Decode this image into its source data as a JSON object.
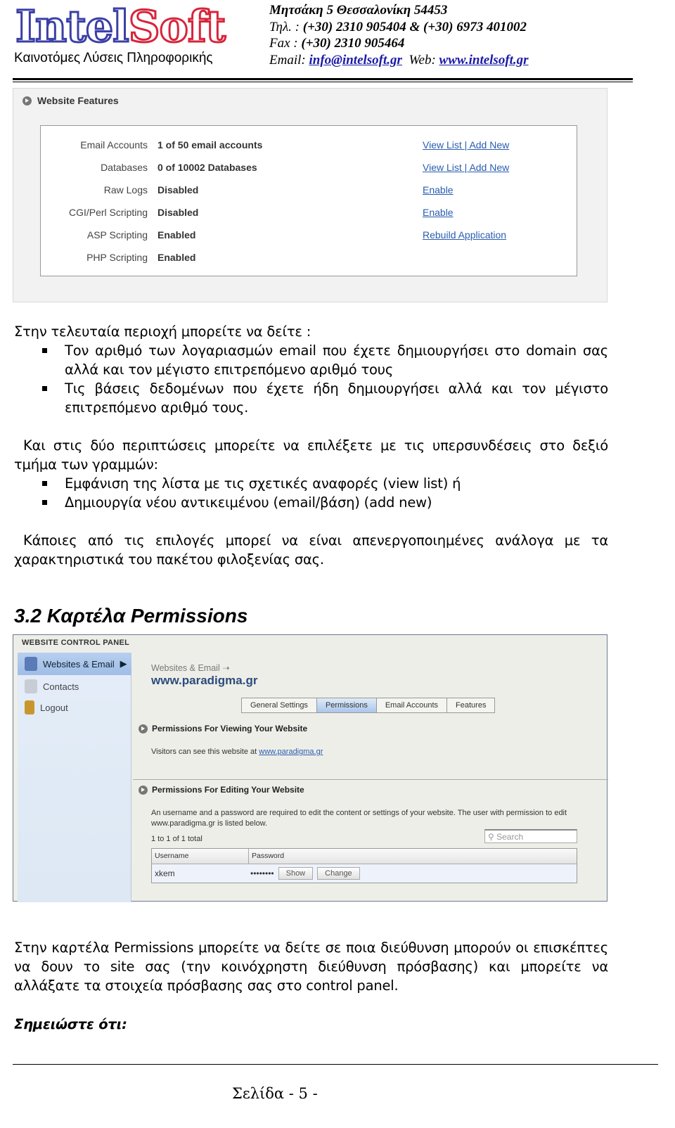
{
  "header": {
    "logo": {
      "part1": "Intel",
      "part2": "Soft",
      "colors": {
        "intel": "#3a3fa6",
        "soft": "#d8253a"
      }
    },
    "tagline": "Καινοτόμες Λύσεις Πληροφορικής",
    "address": "Μητσάκη 5   Θεσσαλονίκη 54453",
    "phone_label": "Τηλ. :",
    "phone": "(+30) 2310 905404  &  (+30) 6973 401002",
    "fax_label": "Fax :",
    "fax": "(+30) 2310 905464",
    "email_label": "Email:",
    "email": "info@intelsoft.gr",
    "web_label": "Web:",
    "web": "www.intelsoft.gr"
  },
  "features": {
    "title": "Website Features",
    "rows": [
      {
        "label": "Email Accounts",
        "value": "1 of 50 email accounts",
        "link1": "View List",
        "sep": "|",
        "link2": "Add New"
      },
      {
        "label": "Databases",
        "value": "0 of 10002 Databases",
        "link1": "View List",
        "sep": "|",
        "link2": "Add New"
      },
      {
        "label": "Raw Logs",
        "value": "Disabled",
        "link1": "Enable"
      },
      {
        "label": "CGI/Perl Scripting",
        "value": "Disabled",
        "link1": "Enable"
      },
      {
        "label": "ASP Scripting",
        "value": "Enabled",
        "link1": "Rebuild Application"
      },
      {
        "label": "PHP Scripting",
        "value": "Enabled"
      }
    ]
  },
  "body": {
    "p1": "Στην τελευταία περιοχή μπορείτε να δείτε :",
    "b1": "Τον αριθμό των λογαριασμών email που έχετε δημιουργήσει στο domain σας αλλά και τον μέγιστο επιτρεπόμενο αριθμό τους",
    "b2": "Τις βάσεις δεδομένων  που έχετε ήδη δημιουργήσει αλλά και τον μέγιστο επιτρεπόμενο αριθμό τους.",
    "p2": "Και στις δύο περιπτώσεις μπορείτε να επιλέξετε με τις υπερσυνδέσεις στο δεξιό τμήμα των γραμμών:",
    "b3": "Εμφάνιση της λίστα με τις σχετικές αναφορές (view list) ή",
    "b4": "Δημιουργία νέου αντικειμένου (email/βάση) (add new)",
    "p3": "Κάποιες από τις επιλογές μπορεί να είναι απενεργοποιημένες ανάλογα με τα χαρακτηριστικά του πακέτου φιλοξενίας σας.",
    "heading": "3.2  Καρτέλα Permissions",
    "p4": "Στην καρτέλα Permissions μπορείτε να δείτε σε ποια διεύθυνση μπορούν οι επισκέπτες να δουν το site σας (την κοινόχρηστη διεύθυνση πρόσβασης) και μπορείτε να αλλάξατε τα στοιχεία πρόσβασης σας στο control panel.",
    "note": "Σημειώστε ότι:"
  },
  "panel": {
    "title": "WEBSITE CONTROL PANEL",
    "sidebar": [
      {
        "label": "Websites & Email",
        "icon": "computer-icon"
      },
      {
        "label": "Contacts",
        "icon": "contacts-icon"
      },
      {
        "label": "Logout",
        "icon": "lock-icon"
      }
    ],
    "breadcrumb": "Websites & Email",
    "site": "www.paradigma.gr",
    "tabs": [
      "General Settings",
      "Permissions",
      "Email Accounts",
      "Features"
    ],
    "active_tab": "Permissions",
    "view_title": "Permissions For Viewing Your Website",
    "view_text": "Visitors can see this website at",
    "view_link": "www.paradigma.gr",
    "edit_title": "Permissions For Editing Your Website",
    "edit_text": "An username and a password are required to edit the content or settings of your website. The user with permission to edit www.paradigma.gr is listed below.",
    "count": "1 to 1 of 1 total",
    "search_placeholder": "Search",
    "columns": [
      "Username",
      "Password"
    ],
    "row": {
      "username": "xkem",
      "password": "••••••••",
      "show": "Show",
      "change": "Change"
    }
  },
  "footer": {
    "page": "Σελίδα  - 5 -"
  }
}
